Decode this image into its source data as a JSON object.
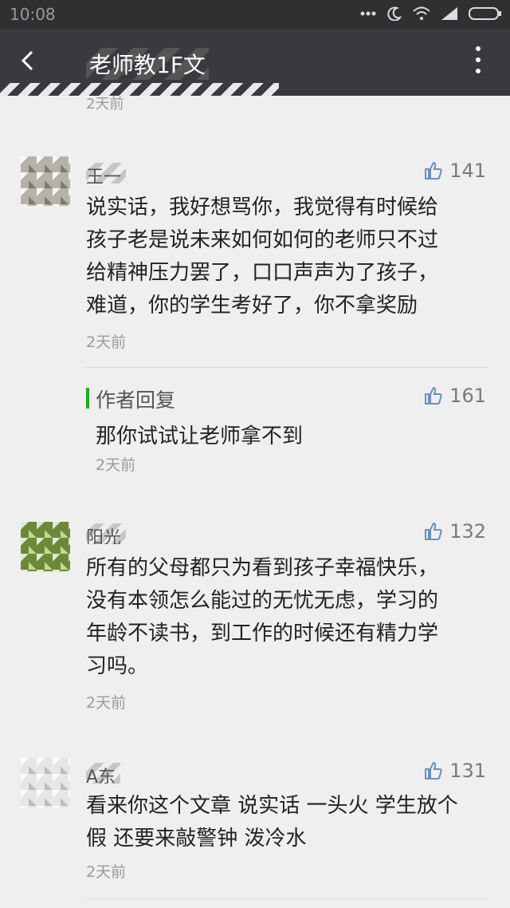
{
  "status_bar": {
    "time": "10:08"
  },
  "toolbar": {
    "title": "老师教1F文"
  },
  "top_time": "2天前",
  "comments": [
    {
      "username": "王一",
      "likes": "141",
      "lines": [
        "说实话，我好想骂你，我觉得有时候给",
        "孩子老是说未来如何如何的老师只不过",
        "给精神压力罢了，口口声声为了孩子，",
        "难道，你的学生考好了，你不拿奖励"
      ],
      "time": "2天前",
      "reply": {
        "label": "作者回复",
        "likes": "161",
        "text": "那你试试让老师拿不到",
        "time": "2天前"
      }
    },
    {
      "username": "阳光",
      "likes": "132",
      "lines": [
        "所有的父母都只为看到孩子幸福快乐，",
        "没有本领怎么能过的无忧无虑，学习的",
        "年龄不读书，到工作的时候还有精力学",
        "习吗。"
      ],
      "time": "2天前"
    },
    {
      "username": "A东",
      "likes": "131",
      "lines": [
        "看来你这个文章 说实话 一头火 学生放个",
        "假 还要来敲警钟 泼冷水"
      ],
      "time": "2天前"
    }
  ]
}
